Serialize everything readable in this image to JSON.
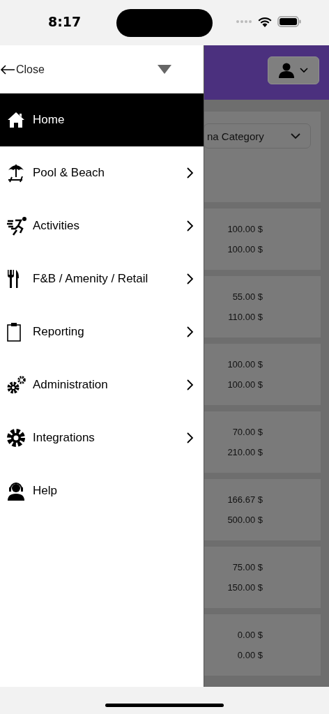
{
  "status_bar": {
    "time": "8:17"
  },
  "drawer": {
    "close_label": "Close",
    "items": [
      {
        "label": "Home",
        "selected": true,
        "has_submenu": false
      },
      {
        "label": "Pool & Beach",
        "selected": false,
        "has_submenu": true
      },
      {
        "label": "Activities",
        "selected": false,
        "has_submenu": true
      },
      {
        "label": "F&B / Amenity / Retail",
        "selected": false,
        "has_submenu": true
      },
      {
        "label": "Reporting",
        "selected": false,
        "has_submenu": true
      },
      {
        "label": "Administration",
        "selected": false,
        "has_submenu": true
      },
      {
        "label": "Integrations",
        "selected": false,
        "has_submenu": true
      },
      {
        "label": "Help",
        "selected": false,
        "has_submenu": false
      }
    ]
  },
  "background_page": {
    "category_select": "na Category",
    "rows": [
      {
        "value_1": "100.00 $",
        "value_2": "100.00 $"
      },
      {
        "value_1": "55.00 $",
        "value_2": "110.00 $"
      },
      {
        "value_1": "100.00 $",
        "value_2": "100.00 $"
      },
      {
        "value_1": "70.00 $",
        "value_2": "210.00 $"
      },
      {
        "value_1": "166.67 $",
        "value_2": "500.00 $"
      },
      {
        "value_1": "75.00 $",
        "value_2": "150.00 $"
      },
      {
        "value_1": "0.00 $",
        "value_2": "0.00 $"
      }
    ]
  }
}
